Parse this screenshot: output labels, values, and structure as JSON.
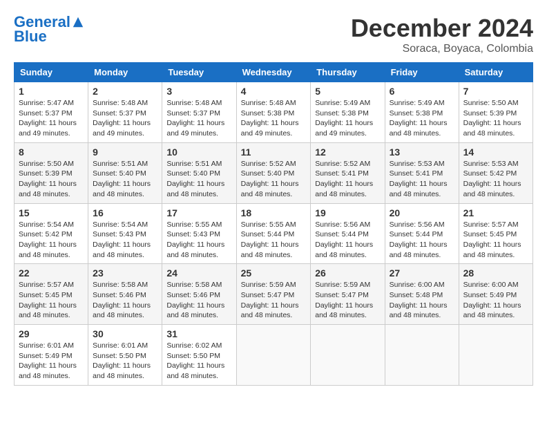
{
  "header": {
    "logo_line1": "General",
    "logo_line2": "Blue",
    "month": "December 2024",
    "location": "Soraca, Boyaca, Colombia"
  },
  "weekdays": [
    "Sunday",
    "Monday",
    "Tuesday",
    "Wednesday",
    "Thursday",
    "Friday",
    "Saturday"
  ],
  "weeks": [
    [
      {
        "day": "1",
        "sunrise": "5:47 AM",
        "sunset": "5:37 PM",
        "daylight": "11 hours and 49 minutes."
      },
      {
        "day": "2",
        "sunrise": "5:48 AM",
        "sunset": "5:37 PM",
        "daylight": "11 hours and 49 minutes."
      },
      {
        "day": "3",
        "sunrise": "5:48 AM",
        "sunset": "5:37 PM",
        "daylight": "11 hours and 49 minutes."
      },
      {
        "day": "4",
        "sunrise": "5:48 AM",
        "sunset": "5:38 PM",
        "daylight": "11 hours and 49 minutes."
      },
      {
        "day": "5",
        "sunrise": "5:49 AM",
        "sunset": "5:38 PM",
        "daylight": "11 hours and 49 minutes."
      },
      {
        "day": "6",
        "sunrise": "5:49 AM",
        "sunset": "5:38 PM",
        "daylight": "11 hours and 48 minutes."
      },
      {
        "day": "7",
        "sunrise": "5:50 AM",
        "sunset": "5:39 PM",
        "daylight": "11 hours and 48 minutes."
      }
    ],
    [
      {
        "day": "8",
        "sunrise": "5:50 AM",
        "sunset": "5:39 PM",
        "daylight": "11 hours and 48 minutes."
      },
      {
        "day": "9",
        "sunrise": "5:51 AM",
        "sunset": "5:40 PM",
        "daylight": "11 hours and 48 minutes."
      },
      {
        "day": "10",
        "sunrise": "5:51 AM",
        "sunset": "5:40 PM",
        "daylight": "11 hours and 48 minutes."
      },
      {
        "day": "11",
        "sunrise": "5:52 AM",
        "sunset": "5:40 PM",
        "daylight": "11 hours and 48 minutes."
      },
      {
        "day": "12",
        "sunrise": "5:52 AM",
        "sunset": "5:41 PM",
        "daylight": "11 hours and 48 minutes."
      },
      {
        "day": "13",
        "sunrise": "5:53 AM",
        "sunset": "5:41 PM",
        "daylight": "11 hours and 48 minutes."
      },
      {
        "day": "14",
        "sunrise": "5:53 AM",
        "sunset": "5:42 PM",
        "daylight": "11 hours and 48 minutes."
      }
    ],
    [
      {
        "day": "15",
        "sunrise": "5:54 AM",
        "sunset": "5:42 PM",
        "daylight": "11 hours and 48 minutes."
      },
      {
        "day": "16",
        "sunrise": "5:54 AM",
        "sunset": "5:43 PM",
        "daylight": "11 hours and 48 minutes."
      },
      {
        "day": "17",
        "sunrise": "5:55 AM",
        "sunset": "5:43 PM",
        "daylight": "11 hours and 48 minutes."
      },
      {
        "day": "18",
        "sunrise": "5:55 AM",
        "sunset": "5:44 PM",
        "daylight": "11 hours and 48 minutes."
      },
      {
        "day": "19",
        "sunrise": "5:56 AM",
        "sunset": "5:44 PM",
        "daylight": "11 hours and 48 minutes."
      },
      {
        "day": "20",
        "sunrise": "5:56 AM",
        "sunset": "5:44 PM",
        "daylight": "11 hours and 48 minutes."
      },
      {
        "day": "21",
        "sunrise": "5:57 AM",
        "sunset": "5:45 PM",
        "daylight": "11 hours and 48 minutes."
      }
    ],
    [
      {
        "day": "22",
        "sunrise": "5:57 AM",
        "sunset": "5:45 PM",
        "daylight": "11 hours and 48 minutes."
      },
      {
        "day": "23",
        "sunrise": "5:58 AM",
        "sunset": "5:46 PM",
        "daylight": "11 hours and 48 minutes."
      },
      {
        "day": "24",
        "sunrise": "5:58 AM",
        "sunset": "5:46 PM",
        "daylight": "11 hours and 48 minutes."
      },
      {
        "day": "25",
        "sunrise": "5:59 AM",
        "sunset": "5:47 PM",
        "daylight": "11 hours and 48 minutes."
      },
      {
        "day": "26",
        "sunrise": "5:59 AM",
        "sunset": "5:47 PM",
        "daylight": "11 hours and 48 minutes."
      },
      {
        "day": "27",
        "sunrise": "6:00 AM",
        "sunset": "5:48 PM",
        "daylight": "11 hours and 48 minutes."
      },
      {
        "day": "28",
        "sunrise": "6:00 AM",
        "sunset": "5:49 PM",
        "daylight": "11 hours and 48 minutes."
      }
    ],
    [
      {
        "day": "29",
        "sunrise": "6:01 AM",
        "sunset": "5:49 PM",
        "daylight": "11 hours and 48 minutes."
      },
      {
        "day": "30",
        "sunrise": "6:01 AM",
        "sunset": "5:50 PM",
        "daylight": "11 hours and 48 minutes."
      },
      {
        "day": "31",
        "sunrise": "6:02 AM",
        "sunset": "5:50 PM",
        "daylight": "11 hours and 48 minutes."
      },
      null,
      null,
      null,
      null
    ]
  ]
}
